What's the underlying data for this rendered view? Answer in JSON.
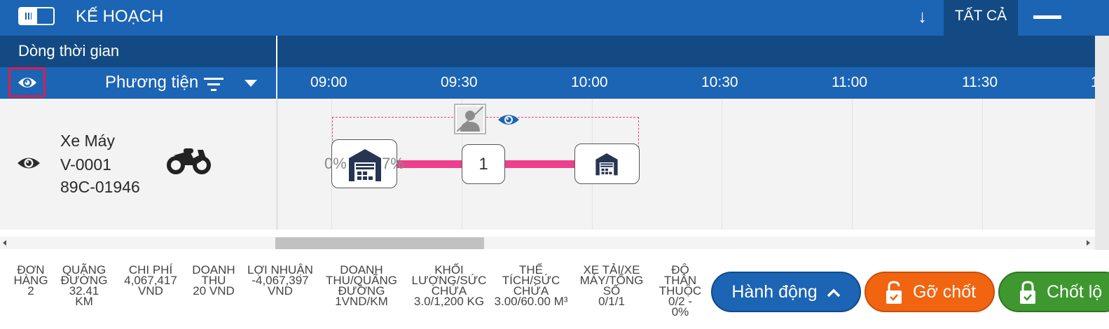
{
  "header": {
    "title": "KẾ HOẠCH",
    "filter_tab": "TẤT CẢ"
  },
  "timeline": {
    "label": "Dòng thời gian",
    "column_vehicle": "Phương tiện",
    "times": [
      "09:00",
      "09:30",
      "10:00",
      "10:30",
      "11:00",
      "11:30",
      "1"
    ]
  },
  "vehicle": {
    "type": "Xe Máy",
    "code": "V-0001",
    "plate": "89C-01946"
  },
  "route": {
    "start_pct": "0%",
    "end_pct": "7%",
    "stop_number": "1"
  },
  "stats": [
    {
      "label": "ĐƠN HÀNG",
      "value": "2"
    },
    {
      "label": "QUÃNG ĐƯỜNG",
      "value": "32.41 KM"
    },
    {
      "label": "CHI PHÍ",
      "value": "4,067,417 VND"
    },
    {
      "label": "DOANH THU",
      "value": "20 VND"
    },
    {
      "label": "LỢI NHUẬN",
      "value": "-4,067,397 VND"
    },
    {
      "label": "DOANH THU/QUÃNG ĐƯỜNG",
      "value": "1VND/KM"
    },
    {
      "label": "KHỐI LƯỢNG/SỨC CHỨA",
      "value": "3.0/1,200 KG"
    },
    {
      "label": "THỂ TÍCH/SỨC CHỨA",
      "value": "3.00/60.00 M³"
    },
    {
      "label": "XE TẢI/XE MÁY/TỔNG SỐ",
      "value": "0/1/1"
    },
    {
      "label": "ĐỘ THÂN THUỘC",
      "value": "0/2 - 0%"
    }
  ],
  "actions": {
    "action_label": "Hành động",
    "unlock_label": "Gỡ chốt",
    "lock_label": "Chốt lộ"
  },
  "colors": {
    "primary": "#1c64b4",
    "dark_primary": "#134a83",
    "route": "#ed3f8c",
    "unlock": "#f16511",
    "lock": "#3e982f",
    "highlight": "#e01b4c"
  },
  "icons": [
    "sidebar-toggle-icon",
    "arrow-down-icon",
    "minus-icon",
    "eye-icon",
    "filter-icon",
    "caret-down-icon",
    "motorcycle-icon",
    "warehouse-icon",
    "avatar-placeholder-icon",
    "chevron-up-icon",
    "lock-icon"
  ]
}
